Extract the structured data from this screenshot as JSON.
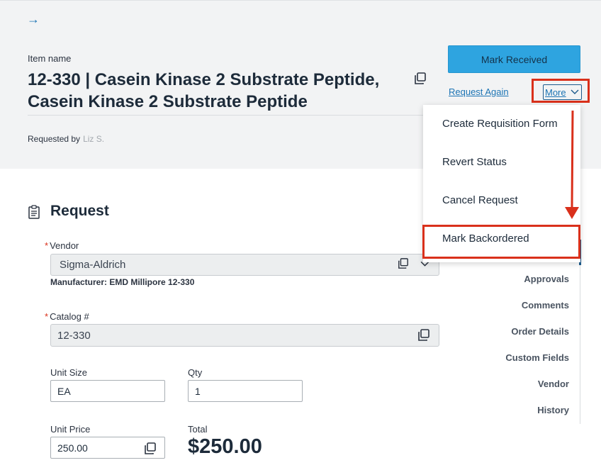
{
  "header": {
    "back_arrow": "→",
    "item_label": "Item name",
    "item_title_line1": "12-330 | Casein Kinase 2 Substrate Peptide,",
    "item_title_line2": "Casein Kinase 2 Substrate Peptide",
    "requested_by_label": "Requested by",
    "requested_by_name": "Liz S."
  },
  "actions": {
    "mark_received": "Mark Received",
    "request_again": "Request Again",
    "more": "More"
  },
  "more_menu": {
    "items": [
      "Create Requisition Form",
      "Revert Status",
      "Cancel Request",
      "Mark Backordered"
    ]
  },
  "request": {
    "section_title": "Request",
    "vendor_label": "Vendor",
    "vendor_value": "Sigma-Aldrich",
    "manufacturer": "Manufacturer: EMD Millipore 12-330",
    "catalog_label": "Catalog #",
    "catalog_value": "12-330",
    "unit_size_label": "Unit Size",
    "unit_size_value": "EA",
    "qty_label": "Qty",
    "qty_value": "1",
    "unit_price_label": "Unit Price",
    "unit_price_value": "250.00",
    "total_label": "Total",
    "total_value": "$250.00",
    "required_mark": "*"
  },
  "side_nav": {
    "items": [
      "Approvals",
      "Comments",
      "Order Details",
      "Custom Fields",
      "Vendor",
      "History"
    ]
  },
  "colors": {
    "primary_button": "#2ea4e0",
    "link": "#1c74b4",
    "annotation_red": "#d9301b",
    "header_bg": "#f2f3f4"
  },
  "icons": {
    "back": "arrow-right-icon",
    "copy": "copy-icon",
    "chevron": "chevron-down-icon",
    "section": "clipboard-icon"
  }
}
